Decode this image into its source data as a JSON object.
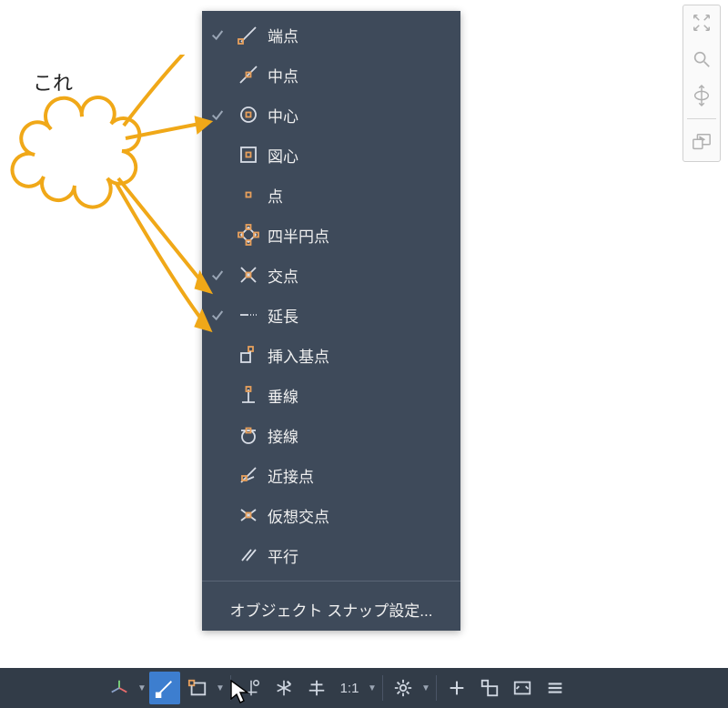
{
  "annotation": {
    "text": "これ"
  },
  "snap_menu": {
    "items": [
      {
        "id": "endpoint",
        "label": "端点",
        "checked": true,
        "icon": "endpoint"
      },
      {
        "id": "midpoint",
        "label": "中点",
        "checked": false,
        "icon": "midpoint"
      },
      {
        "id": "center",
        "label": "中心",
        "checked": true,
        "icon": "center"
      },
      {
        "id": "centroid",
        "label": "図心",
        "checked": false,
        "icon": "centroid"
      },
      {
        "id": "node",
        "label": "点",
        "checked": false,
        "icon": "node"
      },
      {
        "id": "quadrant",
        "label": "四半円点",
        "checked": false,
        "icon": "quadrant"
      },
      {
        "id": "intersect",
        "label": "交点",
        "checked": true,
        "icon": "intersect"
      },
      {
        "id": "extension",
        "label": "延長",
        "checked": true,
        "icon": "extension"
      },
      {
        "id": "insertion",
        "label": "挿入基点",
        "checked": false,
        "icon": "insertion"
      },
      {
        "id": "perp",
        "label": "垂線",
        "checked": false,
        "icon": "perp"
      },
      {
        "id": "tangent",
        "label": "接線",
        "checked": false,
        "icon": "tangent"
      },
      {
        "id": "nearest",
        "label": "近接点",
        "checked": false,
        "icon": "nearest"
      },
      {
        "id": "apparent",
        "label": "仮想交点",
        "checked": false,
        "icon": "apparent"
      },
      {
        "id": "parallel",
        "label": "平行",
        "checked": false,
        "icon": "parallel"
      }
    ],
    "settings_label": "オブジェクト スナップ設定..."
  },
  "statusbar": {
    "scale": "1:1"
  }
}
